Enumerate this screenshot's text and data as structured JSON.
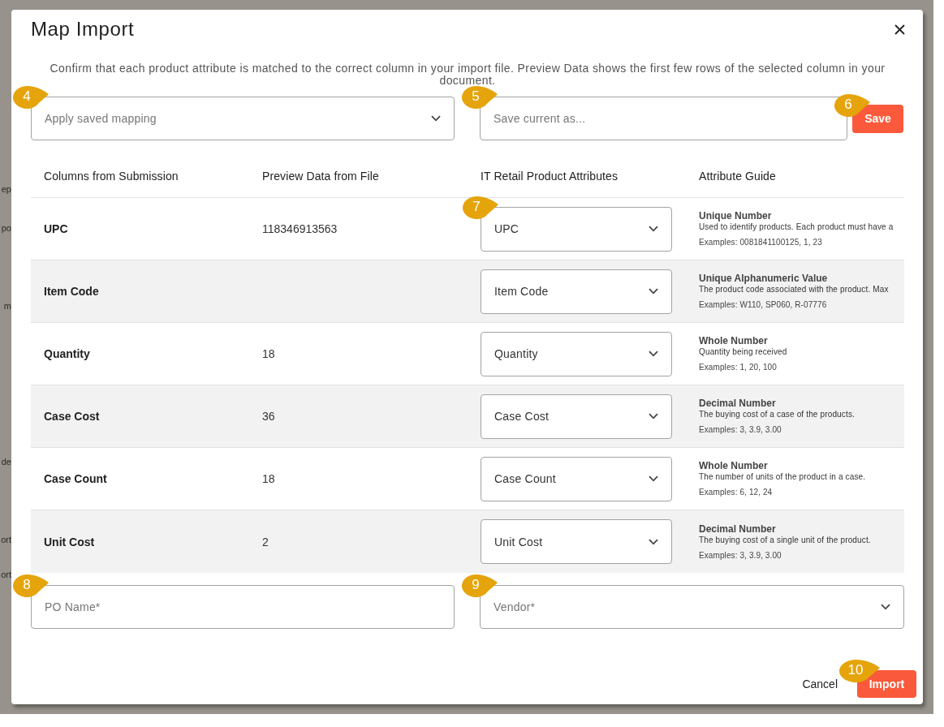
{
  "backdrop": {
    "texts": [
      "ep",
      "po",
      "m",
      "de",
      "ort",
      "ort"
    ]
  },
  "dialog": {
    "title": "Map Import",
    "description": "Confirm that each product attribute is matched to the correct column in your import file. Preview Data shows the first few rows of the selected column in your document."
  },
  "mapping_bar": {
    "fields": [
      {
        "kind": "select",
        "placeholder": "Apply saved mapping",
        "callout": "4"
      },
      {
        "kind": "input",
        "placeholder": "Save current as...",
        "callout": "5"
      }
    ],
    "save_button": {
      "label": "Save",
      "callout": "6"
    }
  },
  "table": {
    "columns": [
      "Columns from Submission",
      "Preview Data from File",
      "IT Retail Product Attributes",
      "Attribute Guide"
    ],
    "rows": [
      {
        "column": "UPC",
        "preview": "118346913563",
        "attribute": "UPC",
        "callout": "7",
        "guide": {
          "type": "Unique Number",
          "description": "Used to identify products. Each product must have a",
          "examples": "Examples: 0081841100125, 1, 23"
        }
      },
      {
        "column": "Item Code",
        "attribute": "Item Code",
        "guide": {
          "type": "Unique Alphanumeric Value",
          "description": "The product code associated with the product. Max",
          "examples": "Examples: W110, SP060, R-07776"
        }
      },
      {
        "column": "Quantity",
        "preview": "18",
        "attribute": "Quantity",
        "guide": {
          "type": "Whole Number",
          "description": "Quantity being received",
          "examples": "Examples: 1, 20, 100"
        }
      },
      {
        "column": "Case Cost",
        "preview": "36",
        "attribute": "Case Cost",
        "guide": {
          "type": "Decimal Number",
          "description": "The buying cost of a case of the products.",
          "examples": "Examples: 3, 3.9, 3.00"
        }
      },
      {
        "column": "Case Count",
        "preview": "18",
        "attribute": "Case Count",
        "guide": {
          "type": "Whole Number",
          "description": "The number of units of the product in a case.",
          "examples": "Examples: 6, 12, 24"
        }
      },
      {
        "column": "Unit Cost",
        "preview": "2",
        "attribute": "Unit Cost",
        "guide": {
          "type": "Decimal Number",
          "description": "The buying cost of a single unit of the product.",
          "examples": "Examples: 3, 3.9, 3.00"
        }
      }
    ]
  },
  "order_fields": [
    {
      "kind": "input",
      "placeholder": "PO Name*",
      "callout": "8"
    },
    {
      "kind": "select",
      "placeholder": "Vendor*",
      "callout": "9"
    }
  ],
  "buttons": [
    {
      "label": "Cancel",
      "kind": "text"
    },
    {
      "label": "Import",
      "kind": "primary",
      "callout": "10"
    }
  ]
}
